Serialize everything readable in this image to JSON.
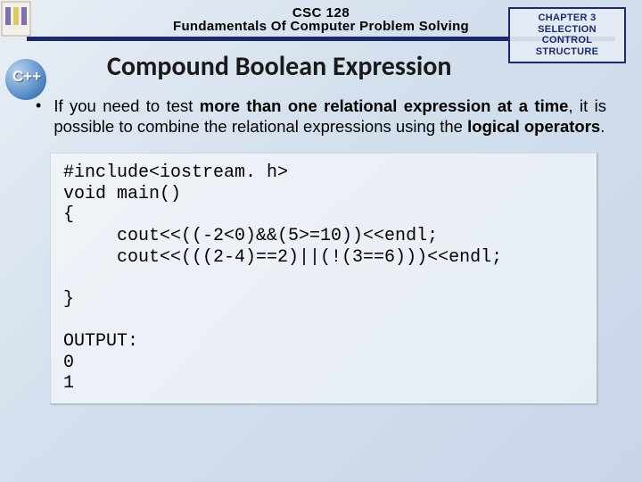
{
  "header": {
    "course_code": "CSC 128",
    "course_title": "Fundamentals Of Computer Problem Solving"
  },
  "chapter_box": {
    "line1": "CHAPTER 3",
    "line2": "SELECTION CONTROL",
    "line3": "STRUCTURE"
  },
  "slide_title": "Compound Boolean Expression",
  "bullet": {
    "pre": "If you need to test ",
    "b1": "more than one relational expression at a time",
    "mid": ", it is possible to combine the relational expressions using the ",
    "b2": "logical operators",
    "post": "."
  },
  "code": "#include<iostream. h>\nvoid main()\n{\n     cout<<((-2<0)&&(5>=10))<<endl;\n     cout<<(((2-4)==2)||(!(3==6)))<<endl;\n\n}\n\nOUTPUT:\n0\n1"
}
